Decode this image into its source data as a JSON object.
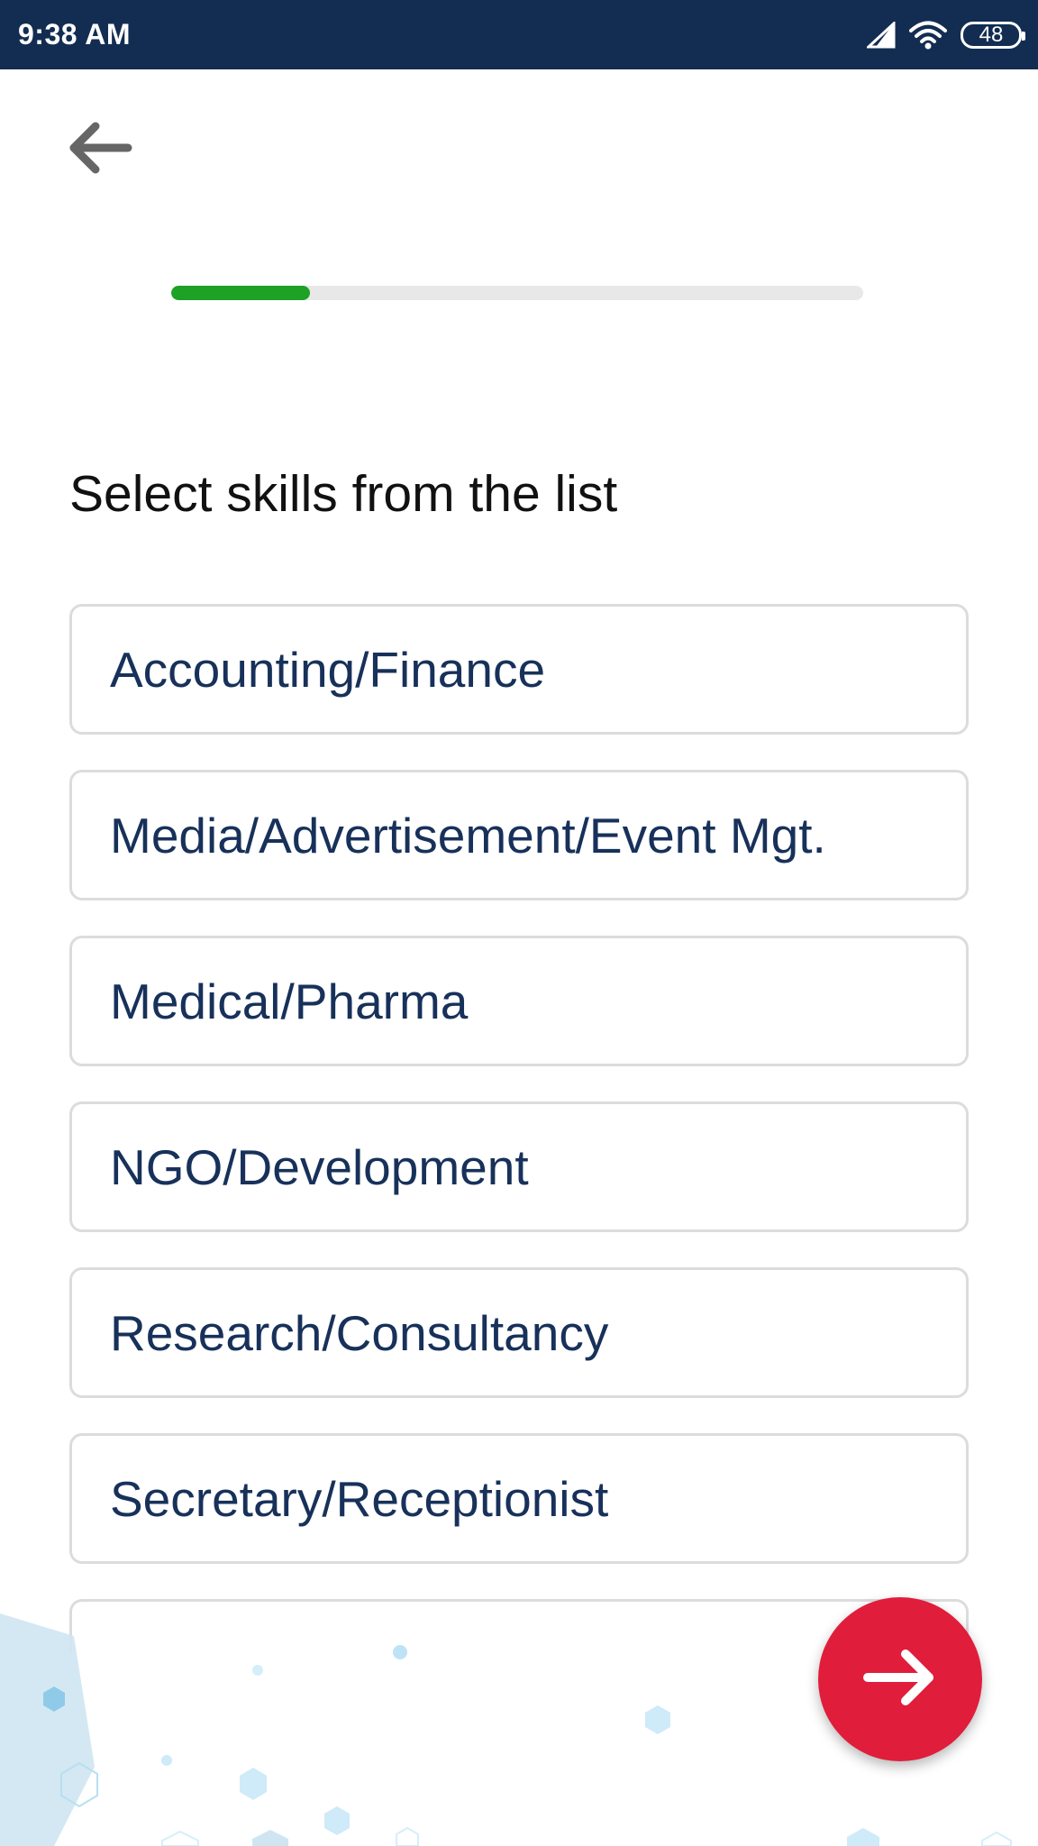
{
  "status_bar": {
    "time": "9:38 AM",
    "battery": "48"
  },
  "progress": {
    "fraction": 0.2
  },
  "title": "Select skills from the list",
  "skills": [
    {
      "label": "Accounting/Finance"
    },
    {
      "label": "Media/Advertisement/Event Mgt."
    },
    {
      "label": "Medical/Pharma"
    },
    {
      "label": "NGO/Development"
    },
    {
      "label": "Research/Consultancy"
    },
    {
      "label": "Secretary/Receptionist"
    }
  ],
  "icons": {
    "back": "arrow-left-icon",
    "next": "arrow-right-icon",
    "signal": "cell-signal-icon",
    "wifi": "wifi-icon",
    "battery": "battery-icon"
  },
  "colors": {
    "status_bar": "#132d52",
    "progress_fill": "#1ea125",
    "progress_track": "#e8e8e8",
    "skill_text": "#17315a",
    "fab": "#e01d3b"
  }
}
